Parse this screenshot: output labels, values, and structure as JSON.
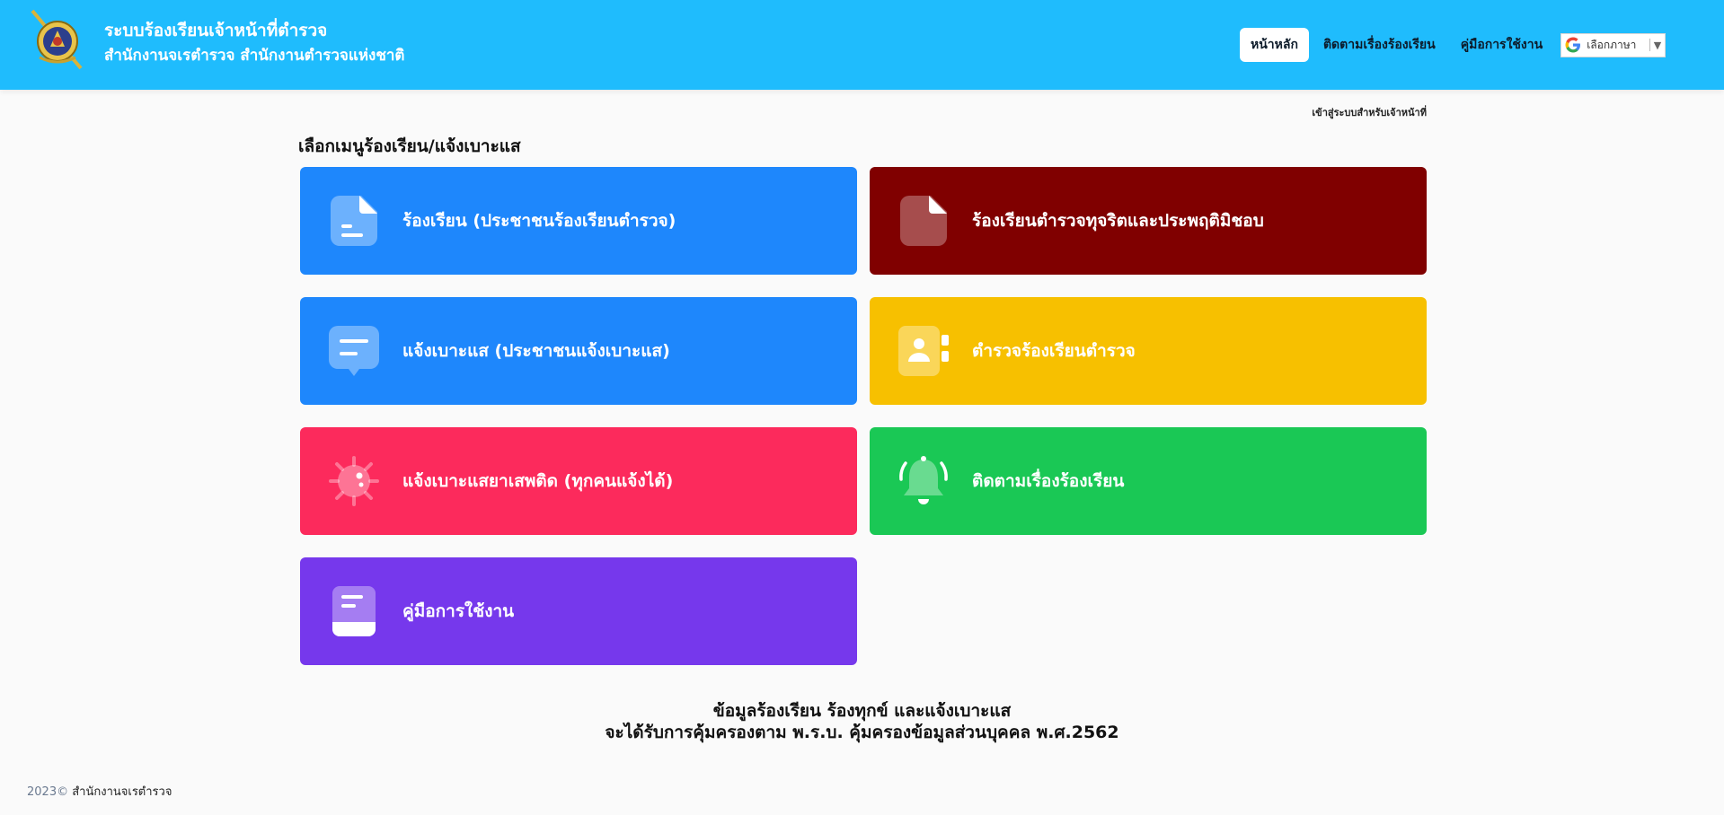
{
  "header": {
    "title": "ระบบร้องเรียนเจ้าหน้าที่ตำรวจ",
    "subtitle": "สำนักงานจเรตำรวจ สำนักงานตำรวจแห่งชาติ",
    "logo_icon": "police-emblem-icon",
    "bg_color": "#1fbcfd"
  },
  "nav": {
    "home": "หน้าหลัก",
    "track": "ติดตามเรื่องร้องเรียน",
    "manual": "คู่มือการใช้งาน",
    "language": "เลือกภาษา",
    "language_icon": "google-g-icon"
  },
  "staff_login": "เข้าสู่ระบบสำหรับเจ้าหน้าที่",
  "section_title": "เลือกเมนูร้องเรียน/แจ้งเบาะแส",
  "menu": [
    {
      "label": "ร้องเรียน (ประชาชนร้องเรียนตำรวจ)",
      "icon": "document-icon",
      "color": "#1e87fc"
    },
    {
      "label": "ร้องเรียนตำรวจทุจริตและประพฤติมิชอบ",
      "icon": "document-icon",
      "color": "#800000"
    },
    {
      "label": "แจ้งเบาะแส (ประชาชนแจ้งเบาะแส)",
      "icon": "chat-bubble-icon",
      "color": "#1e87fc"
    },
    {
      "label": "ตำรวจร้องเรียนตำรวจ",
      "icon": "contact-book-icon",
      "color": "#f7c000"
    },
    {
      "label": "แจ้งเบาะแสยาเสพติด (ทุกคนแจ้งได้)",
      "icon": "virus-icon",
      "color": "#fc2a5c"
    },
    {
      "label": "ติดตามเรื่องร้องเรียน",
      "icon": "bell-icon",
      "color": "#1ac855"
    },
    {
      "label": "คู่มือการใช้งาน",
      "icon": "book-icon",
      "color": "#7638ec"
    }
  ],
  "notice": {
    "line1": "ข้อมูลร้องเรียน ร้องทุกข์ และแจ้งเบาะแส",
    "line2": "จะได้รับการคุ้มครองตาม พ.ร.บ. คุ้มครองข้อมูลส่วนบุคคล พ.ศ.2562"
  },
  "footer": {
    "year": "2023©",
    "org": "สำนักงานจเรตำรวจ"
  }
}
